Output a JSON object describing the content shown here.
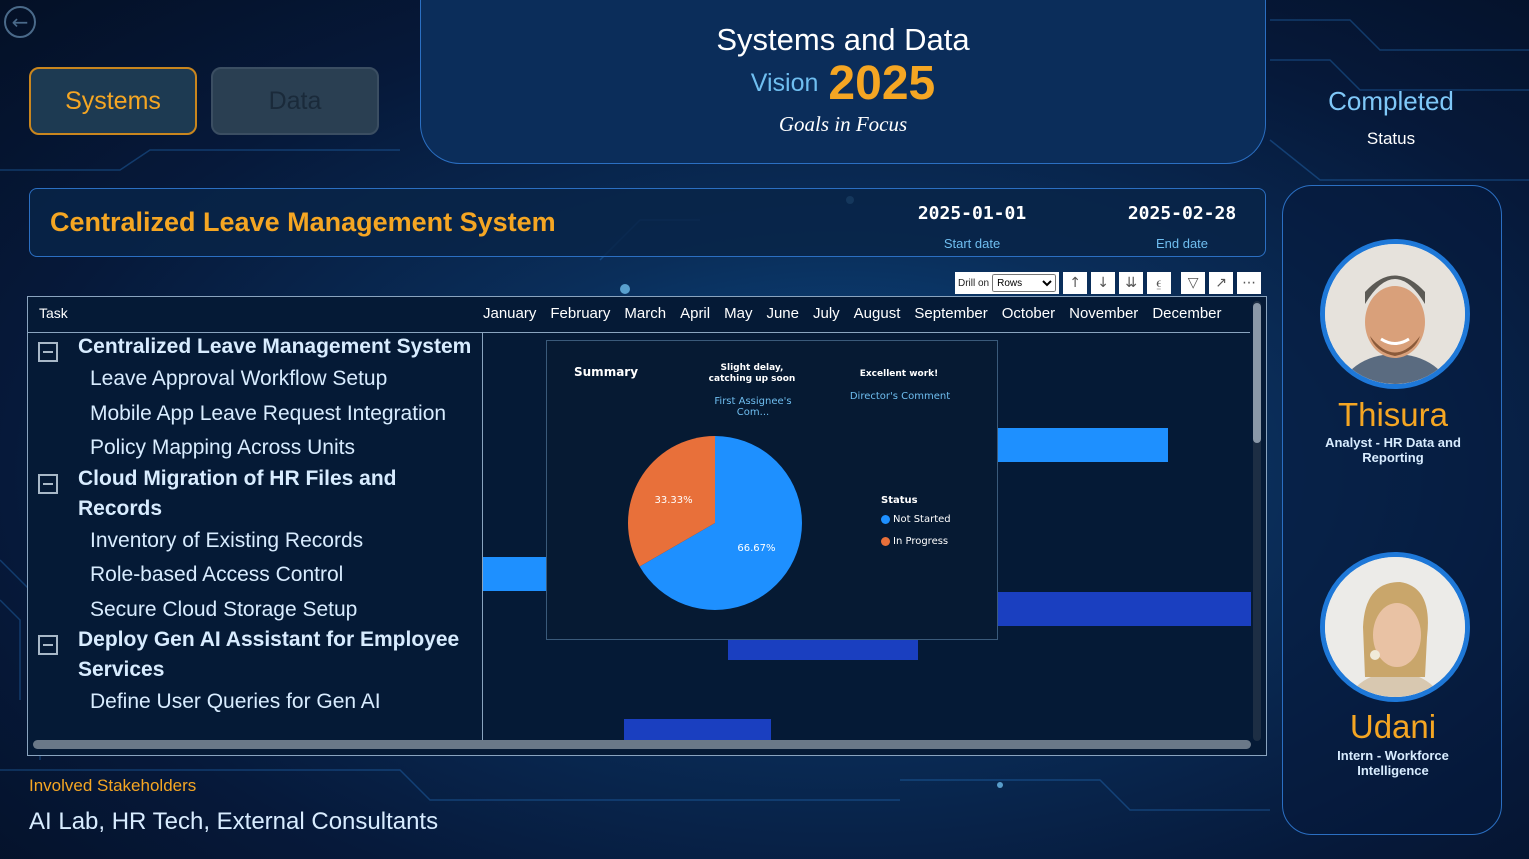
{
  "header": {
    "title": "Systems and Data",
    "vision_label": "Vision",
    "year": "2025",
    "subtitle": "Goals in Focus"
  },
  "nav": {
    "systems_label": "Systems",
    "data_label": "Data"
  },
  "status": {
    "value": "Completed",
    "label": "Status"
  },
  "project": {
    "title": "Centralized Leave Management System",
    "start_date": "2025-01-01",
    "start_label": "Start date",
    "end_date": "2025-02-28",
    "end_label": "End date"
  },
  "toolbar": {
    "drill_label": "Drill on",
    "drill_value": "Rows",
    "icons": [
      "drill-up-icon",
      "drill-down-icon",
      "expand-all-icon",
      "expand-hierarchy-icon",
      "filter-icon",
      "focus-mode-icon",
      "more-options-icon"
    ]
  },
  "gantt": {
    "task_header": "Task",
    "months": [
      "January",
      "February",
      "March",
      "April",
      "May",
      "June",
      "July",
      "August",
      "September",
      "October",
      "November",
      "December"
    ],
    "groups": [
      {
        "title": "Centralized Leave Management System",
        "tasks": [
          "Leave Approval Workflow Setup",
          "Mobile App Leave Request Integration",
          "Policy Mapping Across Units"
        ]
      },
      {
        "title": "Cloud Migration of HR Files and Records",
        "tasks": [
          "Inventory of Existing Records",
          "Role-based Access Control",
          "Secure Cloud Storage Setup"
        ]
      },
      {
        "title": "Deploy Gen AI Assistant for Employee Services",
        "tasks": [
          "Define User Queries for Gen AI"
        ]
      }
    ]
  },
  "tooltip": {
    "summary_label": "Summary",
    "comment1": "Slight delay, catching up soon",
    "comment1_label": "First Assignee's Com...",
    "comment2": "Excellent work!",
    "comment2_label": "Director's Comment",
    "legend_title": "Status",
    "colors": {
      "not_started": "#1e90ff",
      "in_progress": "#e8703a"
    }
  },
  "chart_data": {
    "type": "pie",
    "title": "",
    "categories": [
      "Not Started",
      "In Progress"
    ],
    "values": [
      66.67,
      33.33
    ],
    "labels": [
      "66.67%",
      "33.33%"
    ],
    "legend_title": "Status",
    "legend_placement": "right"
  },
  "stakeholders": {
    "label": "Involved Stakeholders",
    "value": "AI Lab, HR Tech, External Consultants"
  },
  "team": [
    {
      "name": "Thisura",
      "role": "Analyst - HR Data and Reporting"
    },
    {
      "name": "Udani",
      "role": "Intern - Workforce Intelligence"
    }
  ]
}
